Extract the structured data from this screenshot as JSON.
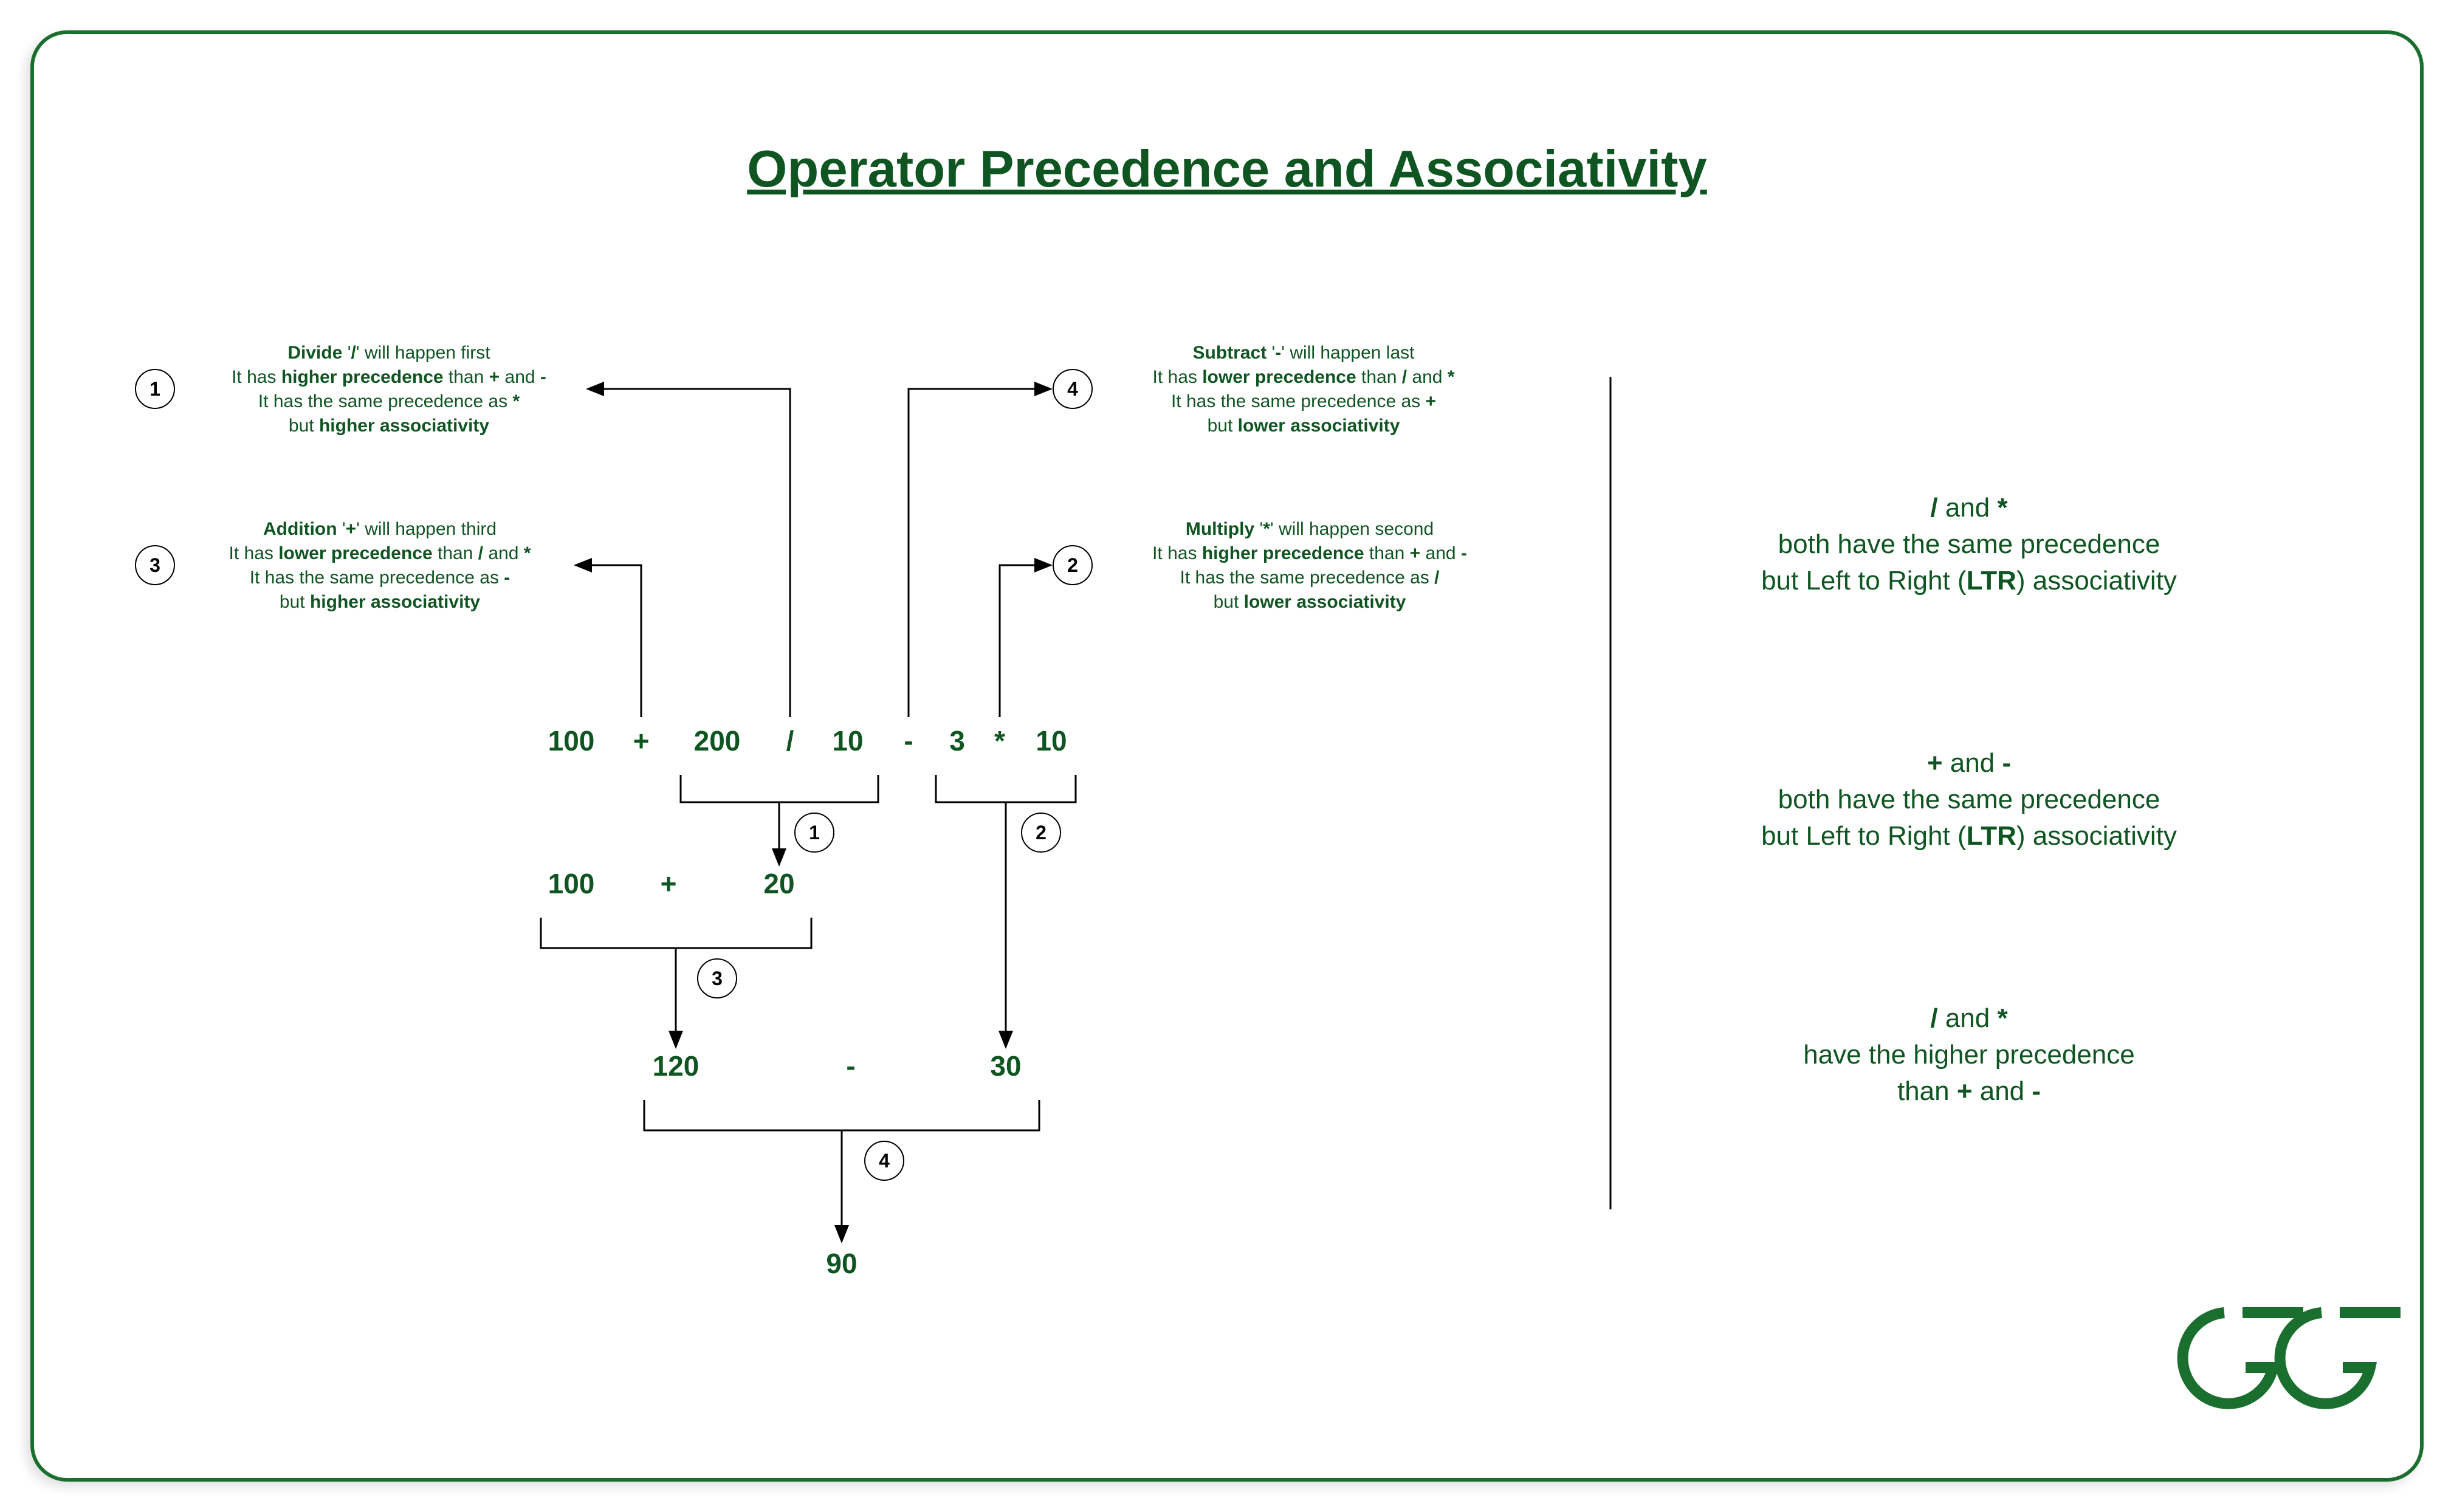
{
  "title": "Operator Precedence and Associativity",
  "expression": {
    "tokens": [
      "100",
      "+",
      "200",
      "/",
      "10",
      "-",
      "3",
      "*",
      "10"
    ]
  },
  "steps": {
    "step1_result_row": {
      "a": "100",
      "op": "+",
      "b": "20"
    },
    "step2_interim": "30",
    "step3_result_row": {
      "a": "120",
      "op": "-",
      "b": "30"
    },
    "final": "90"
  },
  "step_labels": {
    "s1": "1",
    "s2": "2",
    "s3": "3",
    "s4": "4"
  },
  "annotations": {
    "a1": {
      "num": "1",
      "l1_a": "Divide",
      "l1_b": " '",
      "l1_c": "/",
      "l1_d": "' will happen first",
      "l2_a": "It has ",
      "l2_b": "higher precedence",
      "l2_c": " than ",
      "l2_d": "+",
      "l2_e": " and ",
      "l2_f": "-",
      "l3_a": "It has the same precedence as ",
      "l3_b": "*",
      "l4_a": "but ",
      "l4_b": "higher associativity"
    },
    "a3": {
      "num": "3",
      "l1_a": "Addition",
      "l1_b": " '",
      "l1_c": "+",
      "l1_d": "' will happen third",
      "l2_a": "It has ",
      "l2_b": "lower precedence",
      "l2_c": " than ",
      "l2_d": "/",
      "l2_e": " and ",
      "l2_f": "*",
      "l3_a": "It has the same precedence as ",
      "l3_b": "-",
      "l4_a": "but ",
      "l4_b": "higher associativity"
    },
    "a4": {
      "num": "4",
      "l1_a": "Subtract",
      "l1_b": " '",
      "l1_c": "-",
      "l1_d": "' will happen last",
      "l2_a": "It has ",
      "l2_b": "lower precedence",
      "l2_c": " than ",
      "l2_d": "/",
      "l2_e": " and ",
      "l2_f": "*",
      "l3_a": "It has the same precedence as ",
      "l3_b": "+",
      "l4_a": "but ",
      "l4_b": "lower associativity"
    },
    "a2": {
      "num": "2",
      "l1_a": "Multiply",
      "l1_b": " '",
      "l1_c": "*",
      "l1_d": "' will happen second",
      "l2_a": "It has ",
      "l2_b": "higher precedence",
      "l2_c": " than ",
      "l2_d": "+",
      "l2_e": " and ",
      "l2_f": "-",
      "l3_a": "It has the same precedence as ",
      "l3_b": "/",
      "l4_a": "but ",
      "l4_b": "lower associativity"
    }
  },
  "sidebar": {
    "block1": {
      "l1a": "/",
      "l1b": " and ",
      "l1c": "*",
      "l2": "both have the same precedence",
      "l3a": "but Left to Right (",
      "l3b": "LTR",
      "l3c": ") associativity"
    },
    "block2": {
      "l1a": "+",
      "l1b": " and ",
      "l1c": "-",
      "l2": "both have the same precedence",
      "l3a": "but Left to Right (",
      "l3b": "LTR",
      "l3c": ") associativity"
    },
    "block3": {
      "l1a": "/",
      "l1b": " and ",
      "l1c": "*",
      "l2": "have the higher precedence",
      "l3a": "than ",
      "l3b": "+",
      "l3c": " and ",
      "l3d": "-"
    }
  },
  "chart_data": {
    "type": "tree",
    "expression": "100 + 200 / 10 - 3 * 10",
    "evaluation_order": [
      {
        "step": 1,
        "op": "/",
        "operands": [
          200,
          10
        ],
        "result": 20,
        "reason": "higher precedence than + and -, same as * but leftmost → higher associativity (LTR)"
      },
      {
        "step": 2,
        "op": "*",
        "operands": [
          3,
          10
        ],
        "result": 30,
        "reason": "higher precedence than + and -, same as / but lower associativity (rightmost)"
      },
      {
        "step": 3,
        "op": "+",
        "operands": [
          100,
          20
        ],
        "result": 120,
        "reason": "lower precedence than / and *, same as - but leftmost → higher associativity (LTR)"
      },
      {
        "step": 4,
        "op": "-",
        "operands": [
          120,
          30
        ],
        "result": 90,
        "reason": "lower precedence than / and *, same as + but lower associativity (rightmost)"
      }
    ],
    "final_result": 90,
    "rules": [
      "/ and * have the same precedence, Left-to-Right associativity",
      "+ and - have the same precedence, Left-to-Right associativity",
      "/ and * have higher precedence than + and -"
    ]
  }
}
